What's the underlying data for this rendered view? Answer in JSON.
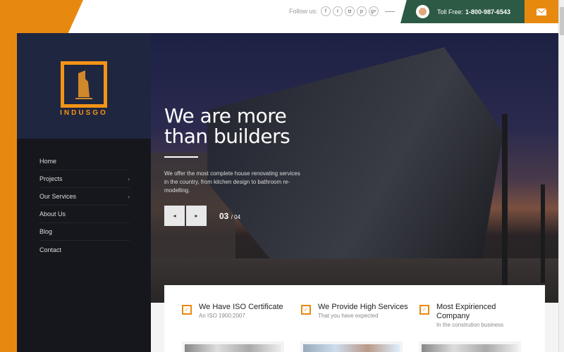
{
  "header": {
    "follow_label": "Follow us:",
    "socials": [
      {
        "icon": "facebook-icon",
        "glyph": "f"
      },
      {
        "icon": "twitter-icon",
        "glyph": "t"
      },
      {
        "icon": "instagram-icon",
        "glyph": "◘"
      },
      {
        "icon": "pinterest-icon",
        "glyph": "p"
      },
      {
        "icon": "google-plus-icon",
        "glyph": "g+"
      }
    ],
    "toll_label": "Toll Free:",
    "phone": "1-800-987-6543"
  },
  "colors": {
    "accent": "#e8890f",
    "green": "#2d5a44",
    "sidebar": "#16171d",
    "navy": "#1f2640"
  },
  "brand": {
    "name": "INDUSGO"
  },
  "nav": {
    "items": [
      {
        "label": "Home",
        "sub": false
      },
      {
        "label": "Projects",
        "sub": true
      },
      {
        "label": "Our Services",
        "sub": true
      },
      {
        "label": "About Us",
        "sub": false
      },
      {
        "label": "Blog",
        "sub": false
      },
      {
        "label": "Contact",
        "sub": false
      }
    ]
  },
  "hero": {
    "title_1": "We are more",
    "title_2": "than builders",
    "description": "We offer the most complete house renovating services in the country, from kitchen design to bathroom re-modelling.",
    "current": "03",
    "total": "/ 04"
  },
  "features": [
    {
      "title": "We Have ISO Certificate",
      "subtitle": "An ISO 1900:2007"
    },
    {
      "title": "We Provide High Services",
      "subtitle": "That you have expected"
    },
    {
      "title": "Most Expirienced Company",
      "subtitle": "In the constrution business"
    }
  ]
}
